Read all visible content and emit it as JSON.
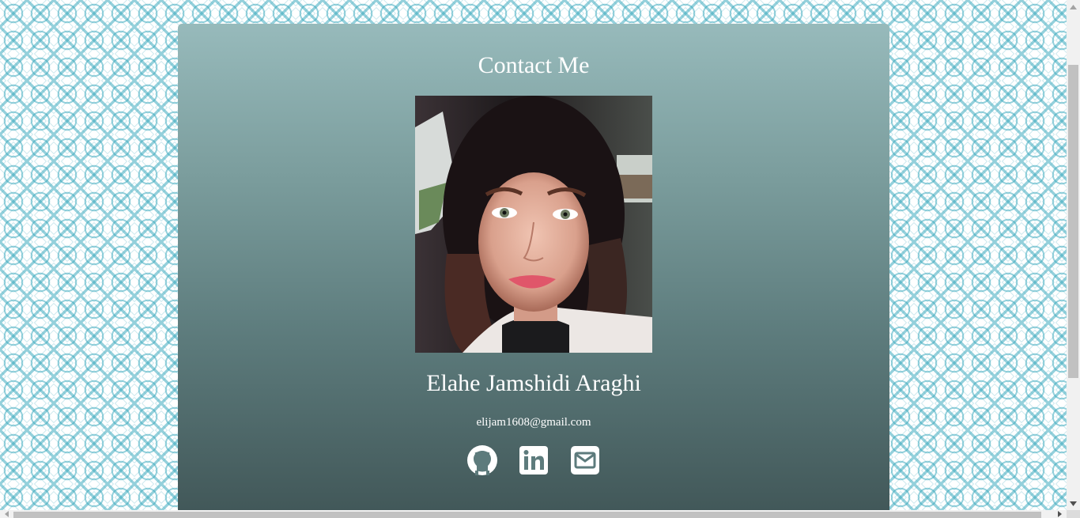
{
  "contact": {
    "title": "Contact Me",
    "name": "Elahe Jamshidi Araghi",
    "email": "elijam1608@gmail.com",
    "photo_alt": "Elahe Jamshidi Araghi",
    "socials": [
      {
        "icon": "github-icon",
        "label": "GitHub"
      },
      {
        "icon": "linkedin-icon",
        "label": "LinkedIn"
      },
      {
        "icon": "envelope-icon",
        "label": "Email"
      }
    ]
  },
  "colors": {
    "card_top": "#97babb",
    "card_bottom": "#3f5455",
    "text": "#ffffff",
    "pattern": "#3caabe"
  }
}
